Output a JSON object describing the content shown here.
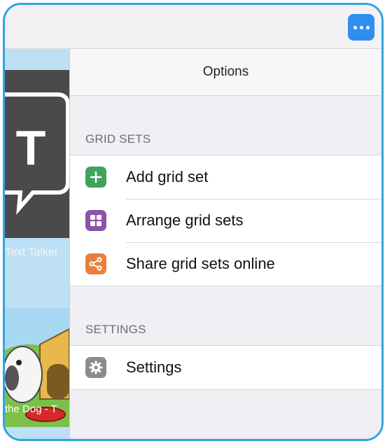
{
  "window": {
    "more_button_icon": "ellipsis-icon"
  },
  "background": {
    "tile1_label": "Text Talker",
    "tile2_label": "the Dog - T"
  },
  "panel": {
    "title": "Options",
    "sections": [
      {
        "header": "GRID SETS",
        "items": [
          {
            "label": "Add grid set",
            "icon": "plus-icon",
            "color": "#3fa35b"
          },
          {
            "label": "Arrange grid sets",
            "icon": "grid-icon",
            "color": "#8d52a6"
          },
          {
            "label": "Share grid sets online",
            "icon": "share-icon",
            "color": "#ea7f3b"
          }
        ]
      },
      {
        "header": "SETTINGS",
        "items": [
          {
            "label": "Settings",
            "icon": "gear-icon",
            "color": "#8a8a8f"
          }
        ]
      }
    ]
  },
  "colors": {
    "accent": "#2f8ef0",
    "frame": "#2ea6e0"
  }
}
